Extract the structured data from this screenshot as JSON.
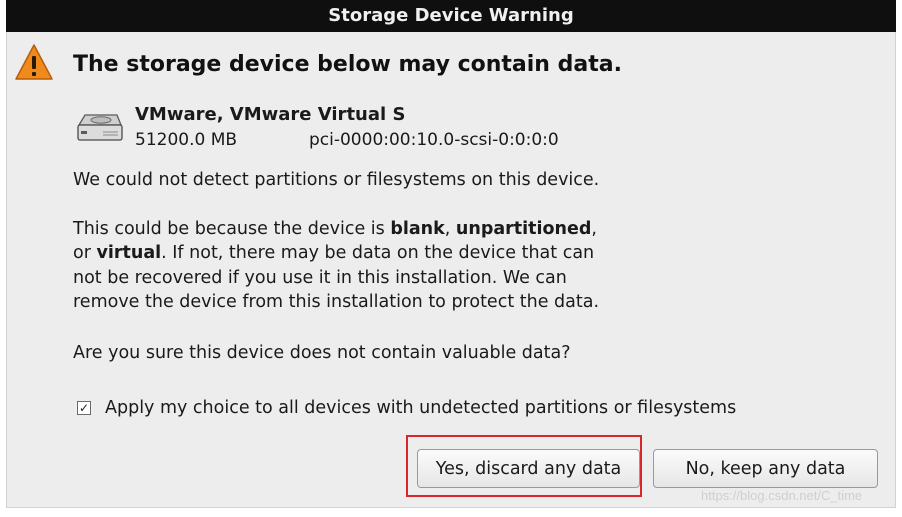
{
  "window": {
    "title": "Storage Device Warning"
  },
  "heading": "The storage device below may contain data.",
  "device": {
    "name": "VMware, VMware Virtual S",
    "size": "51200.0 MB",
    "path": "pci-0000:00:10.0-scsi-0:0:0:0"
  },
  "body": {
    "p1": "We could not detect partitions or filesystems on this device.",
    "p2": {
      "l1a": "This could be because the device is ",
      "blank": "blank",
      "comma": ", ",
      "unpartitioned": "unpartitioned",
      "l1end": ",",
      "l2a": "or ",
      "virtual": "virtual",
      "l2b": ". If not, there may be data on the device that can",
      "l3": "not be recovered if you use it in this installation. We can",
      "l4": "remove the device from this installation to protect the data."
    },
    "p3": "Are you sure this device does not contain valuable data?"
  },
  "apply_all": {
    "label": "Apply my choice to all devices with undetected partitions or filesystems",
    "checked": true,
    "mark": "✓"
  },
  "buttons": {
    "yes": "Yes, discard any data",
    "no": "No, keep any data"
  },
  "watermark": "https://blog.csdn.net/C_time",
  "colors": {
    "titlebar": "#0f0f0f",
    "dialog_bg": "#ededed",
    "highlight": "#d8262b",
    "warning": "#f08a1c"
  }
}
